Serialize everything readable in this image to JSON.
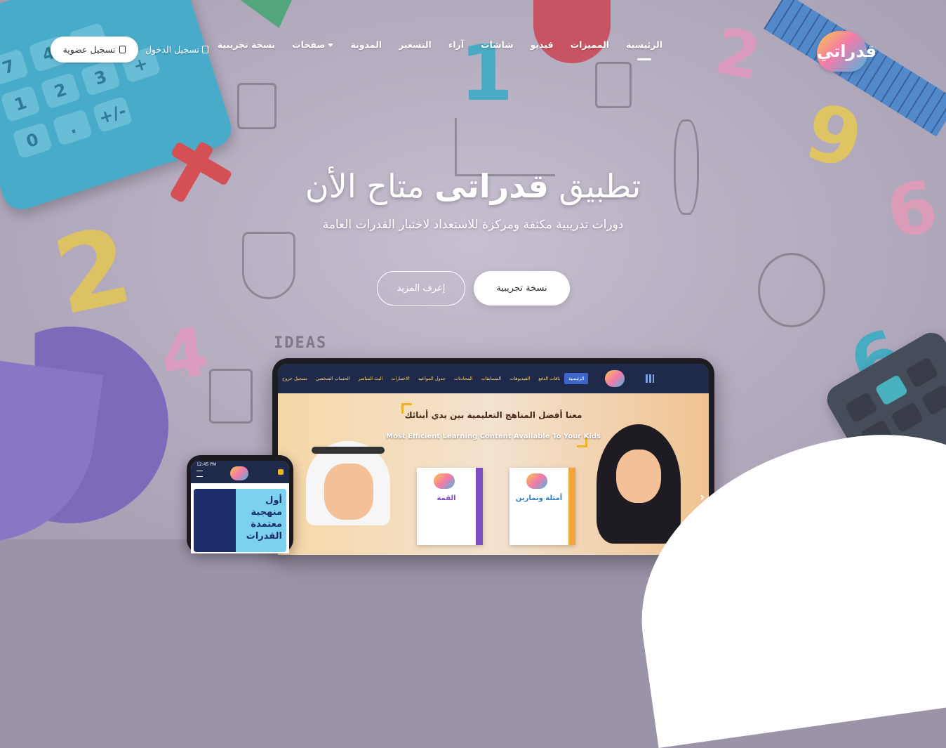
{
  "brand": {
    "logo_text": "قدراتي"
  },
  "nav": {
    "items": [
      {
        "label": "الرئيسية",
        "active": true
      },
      {
        "label": "المميزات"
      },
      {
        "label": "فيديو"
      },
      {
        "label": "شاشات"
      },
      {
        "label": "آراء"
      },
      {
        "label": "التسعير"
      },
      {
        "label": "المدونة"
      },
      {
        "label": "صفحات",
        "has_dropdown": true
      },
      {
        "label": "نسخة تجريبية"
      }
    ]
  },
  "auth": {
    "register_label": "تسجيل عضوية",
    "login_label": "تسجيل الدخول"
  },
  "hero": {
    "title_prefix": "تطبيق",
    "title_brand": "قدراتى",
    "title_suffix": "متاح الأن",
    "subtitle": "دورات تدريبية مكثفة ومركزة للاستعداد لاختبار القدرات العامة",
    "primary_cta": "نسخة تجريبية",
    "secondary_cta": "إعرف المزيد"
  },
  "decor": {
    "ideas_text": "IDEAS"
  },
  "tablet": {
    "nav_items": [
      "الرئيسية",
      "باقات الدفع",
      "الفيديوهات",
      "المسابقات",
      "المحادثات",
      "جدول المواعيد",
      "الاختبارات",
      "البث المباشر",
      "الحساب الشخصي",
      "تسجيل خروج"
    ],
    "headline_ar": "معنا أفضل المناهج التعليمية بين يدي أبنائك",
    "headline_en": "Most Efficient Learning Content Available To Your Kids",
    "book1_title": "القمة",
    "book2_title": "أمثلة وتمارين"
  },
  "phone": {
    "status_time": "12:45 PM",
    "banner_text": "أول منهجية معتمدة القدرات"
  },
  "colors": {
    "accent": "#ffffff",
    "tablet_nav_bg": "#1f2a4a",
    "tablet_nav_text": "#ffd36b",
    "tablet_active": "#3e66c9"
  }
}
